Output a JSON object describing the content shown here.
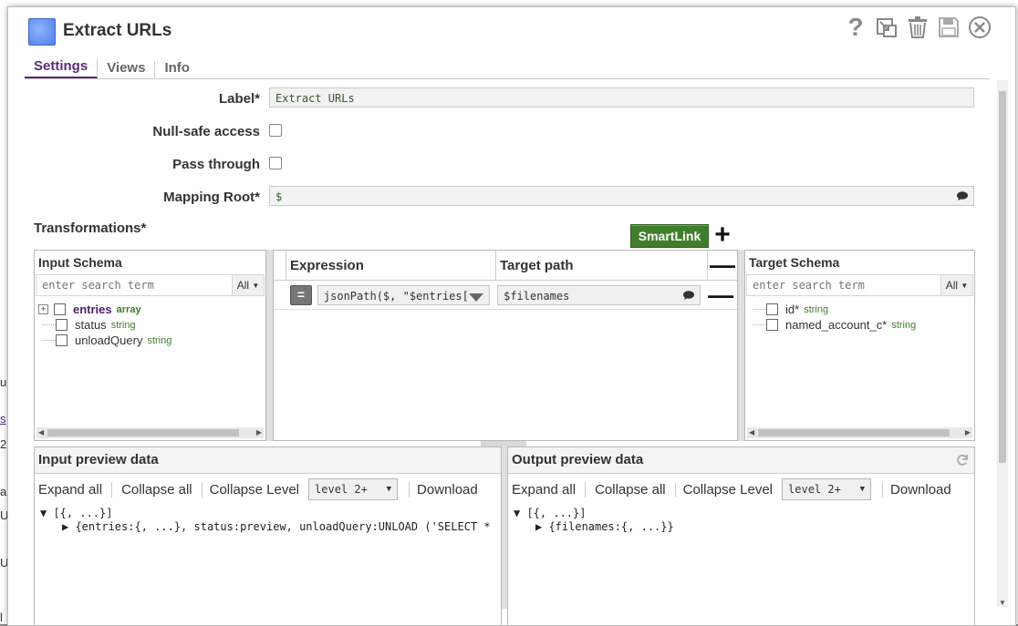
{
  "title": "Extract URLs",
  "tabs": [
    "Settings",
    "Views",
    "Info"
  ],
  "toolbar_icons": [
    "help-icon",
    "export-icon",
    "delete-icon",
    "save-icon",
    "close-icon"
  ],
  "toolbar_help": "?",
  "form": {
    "label_label": "Label*",
    "label_value": "Extract URLs",
    "null_safe_label": "Null-safe access",
    "pass_through_label": "Pass through",
    "mapping_root_label": "Mapping Root*",
    "mapping_root_value": "$"
  },
  "transformations_title": "Transformations*",
  "smartlink_label": "SmartLink",
  "plus": "+",
  "minus": "—",
  "input_schema": {
    "title": "Input Schema",
    "search_placeholder": "enter search term",
    "filter": "All",
    "fields": [
      {
        "name": "entries",
        "type": "array"
      },
      {
        "name": "status",
        "type": "string"
      },
      {
        "name": "unloadQuery",
        "type": "string"
      }
    ]
  },
  "mapping_table": {
    "headers": [
      "Expression",
      "Target path"
    ],
    "eq_label": "=",
    "rows": [
      {
        "expression": "jsonPath($, \"$entries[",
        "target": "$filenames"
      }
    ]
  },
  "target_schema": {
    "title": "Target Schema",
    "search_placeholder": "enter search term",
    "filter": "All",
    "fields": [
      {
        "name": "id*",
        "type": "string"
      },
      {
        "name": "named_account_c*",
        "type": "string"
      }
    ]
  },
  "input_preview": {
    "title": "Input preview data",
    "expand": "Expand all",
    "collapse": "Collapse all",
    "collapse_level": "Collapse Level",
    "level": "level 2+",
    "download": "Download",
    "tree": [
      "▼ [{, ...}]",
      "   ▶ {entries:{, ...}, status:preview, unloadQuery:UNLOAD ('SELECT *"
    ]
  },
  "output_preview": {
    "title": "Output preview data",
    "expand": "Expand all",
    "collapse": "Collapse all",
    "collapse_level": "Collapse Level",
    "level": "level 2+",
    "download": "Download",
    "tree": [
      "▼ [{, ...}]",
      "   ▶ {filenames:{, ...}}"
    ]
  },
  "background_fragments": [
    "u",
    "s",
    "2",
    "a",
    "U",
    "U",
    "l"
  ]
}
